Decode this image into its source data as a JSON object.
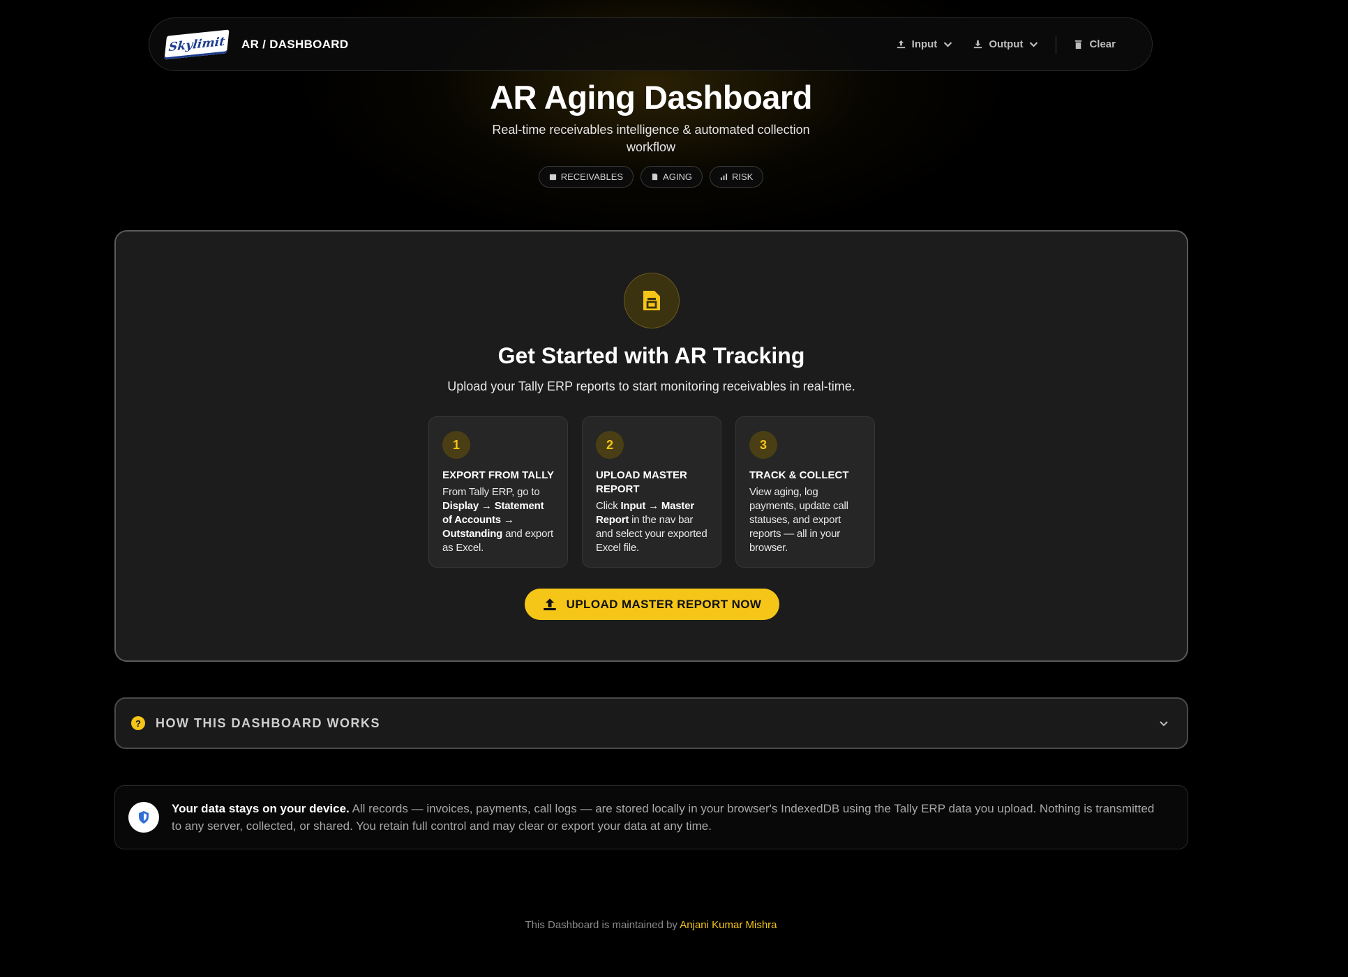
{
  "nav": {
    "logo_text": "Skylimit",
    "brand": "AR / DASHBOARD",
    "input_label": "Input",
    "output_label": "Output",
    "clear_label": "Clear"
  },
  "hero": {
    "title": "AR Aging Dashboard",
    "subtitle": "Real-time receivables intelligence & automated collection workflow",
    "tags": [
      {
        "label": "RECEIVABLES",
        "icon": "calendar-icon"
      },
      {
        "label": "AGING",
        "icon": "document-icon"
      },
      {
        "label": "RISK",
        "icon": "chart-icon"
      }
    ]
  },
  "card": {
    "title": "Get Started with AR Tracking",
    "subtitle": "Upload your Tally ERP reports to start monitoring receivables in real-time.",
    "steps": [
      {
        "num": "1",
        "title": "EXPORT FROM TALLY",
        "p1": "From Tally ERP, go to ",
        "b1": "Display → Statement of Accounts → Outstanding",
        "p2": " and export as Excel."
      },
      {
        "num": "2",
        "title": "UPLOAD MASTER REPORT",
        "p1": "Click ",
        "b1": "Input → Master Report",
        "p2": " in the nav bar and select your exported Excel file."
      },
      {
        "num": "3",
        "title": "TRACK & COLLECT",
        "p1": "View aging, log payments, update call statuses, and export reports — all in your browser.",
        "b1": "",
        "p2": ""
      }
    ],
    "button_label": "UPLOAD MASTER REPORT NOW"
  },
  "accordion": {
    "label": "HOW THIS DASHBOARD WORKS"
  },
  "privacy": {
    "bold": "Your data stays on your device.",
    "text": " All records — invoices, payments, call logs — are stored locally in your browser's IndexedDB using the Tally ERP data you upload. Nothing is transmitted to any server, collected, or shared. You retain full control and may clear or export your data at any time."
  },
  "footer": {
    "text": "This Dashboard is maintained by ",
    "author": "Anjani Kumar Mishra"
  },
  "colors": {
    "accent": "#f5c518",
    "background": "#000000",
    "card": "#1c1c1c"
  }
}
